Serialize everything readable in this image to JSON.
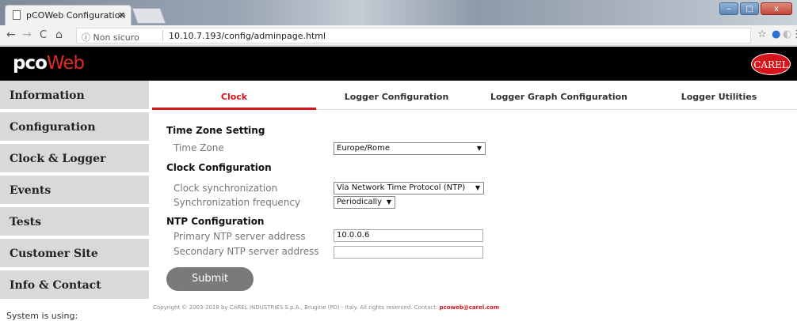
{
  "browser": {
    "tab_title": "pCOWeb Configuration",
    "tab_close": "×",
    "security_label": "ⓘ Non sicuro",
    "url": "10.10.7.193/config/adminpage.html",
    "back": "←",
    "forward": "→",
    "reload": "C",
    "home": "⌂",
    "star": "☆",
    "menu": "⋮"
  },
  "header": {
    "logo_part1": "pco",
    "logo_part2": "Web",
    "brand": "CAREL"
  },
  "sidebar": {
    "items": [
      {
        "label": "Information"
      },
      {
        "label": "Configuration"
      },
      {
        "label": "Clock & Logger"
      },
      {
        "label": "Events"
      },
      {
        "label": "Tests"
      },
      {
        "label": "Customer Site"
      },
      {
        "label": "Info & Contact"
      }
    ],
    "status": "System is using:"
  },
  "tabs": [
    {
      "label": "Clock",
      "active": true
    },
    {
      "label": "Logger Configuration",
      "active": false
    },
    {
      "label": "Logger Graph Configuration",
      "active": false
    },
    {
      "label": "Logger Utilities",
      "active": false
    }
  ],
  "form": {
    "tz_section": "Time Zone Setting",
    "tz_label": "Time Zone",
    "tz_value": "Europe/Rome",
    "clock_section": "Clock Configuration",
    "sync_label": "Clock synchronization",
    "sync_value": "Via Network Time Protocol (NTP)",
    "freq_label": "Synchronization frequency",
    "freq_value": "Periodically",
    "ntp_section": "NTP Configuration",
    "primary_label": "Primary NTP server address",
    "primary_value": "10.0.0.6",
    "secondary_label": "Secondary NTP server address",
    "secondary_value": "",
    "submit": "Submit"
  },
  "footer": {
    "text": "Copyright © 2003-2018 by CAREL INDUSTRIES S.p.A., Brugine (PD) - Italy. All rights reserved. Contact: ",
    "email": "pcoweb@carel.com"
  },
  "colors": {
    "accent": "#d7141a",
    "sidebar_bg": "#d9d9d9",
    "header_bg": "#000000"
  }
}
